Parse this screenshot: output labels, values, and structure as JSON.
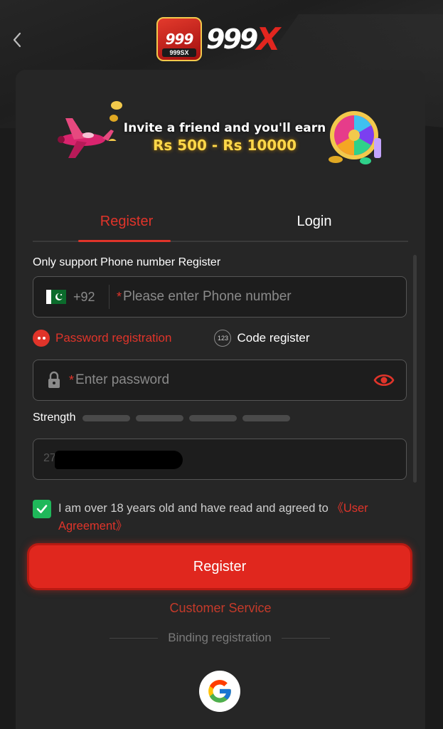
{
  "brand": {
    "logo_badge_text": "999",
    "logo_badge_sub": "999SX",
    "wordmark_main": "999",
    "wordmark_accent": "X",
    "accent_color": "#e0342a"
  },
  "banner": {
    "line1": "Invite a friend and you'll earn",
    "line2": "Rs 500 - Rs 10000"
  },
  "tabs": {
    "register": "Register",
    "login": "Login",
    "active": "register"
  },
  "form": {
    "support_note": "Only support Phone number Register",
    "phone": {
      "country_code": "+92",
      "required_mark": "*",
      "placeholder": "Please enter Phone number"
    },
    "modes": {
      "password_label": "Password registration",
      "code_label": "Code register",
      "code_icon_text": "123",
      "selected": "password"
    },
    "password": {
      "required_mark": "*",
      "placeholder": "Enter password"
    },
    "strength": {
      "label": "Strength",
      "segments": 4
    },
    "extra_field": {
      "visible_fragment": "27600"
    },
    "agreement": {
      "checked": true,
      "text": "I am over 18 years old and have read and agreed to ",
      "link": "《User Agreement》"
    },
    "submit_label": "Register"
  },
  "footer": {
    "customer_service": "Customer Service",
    "binding_label": "Binding registration",
    "google_icon": "google-icon"
  }
}
